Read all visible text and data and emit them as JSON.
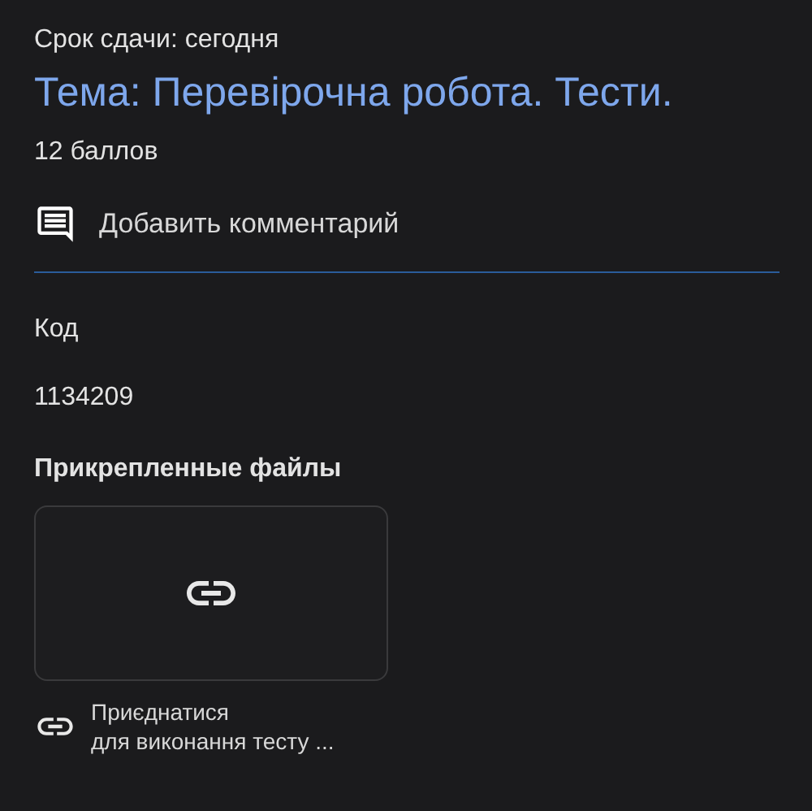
{
  "due": "Срок сдачи: сегодня",
  "title": "Тема: Перевірочна робота. Тести.",
  "points": "12 баллов",
  "comment_action": "Добавить комментарий",
  "fields": [
    {
      "label": "Код",
      "value": "1134209"
    }
  ],
  "attachments": {
    "heading": "Прикрепленные файлы",
    "items": [
      {
        "kind": "link",
        "title": "Приєднатися",
        "subtitle": "для виконання тесту ..."
      }
    ]
  }
}
